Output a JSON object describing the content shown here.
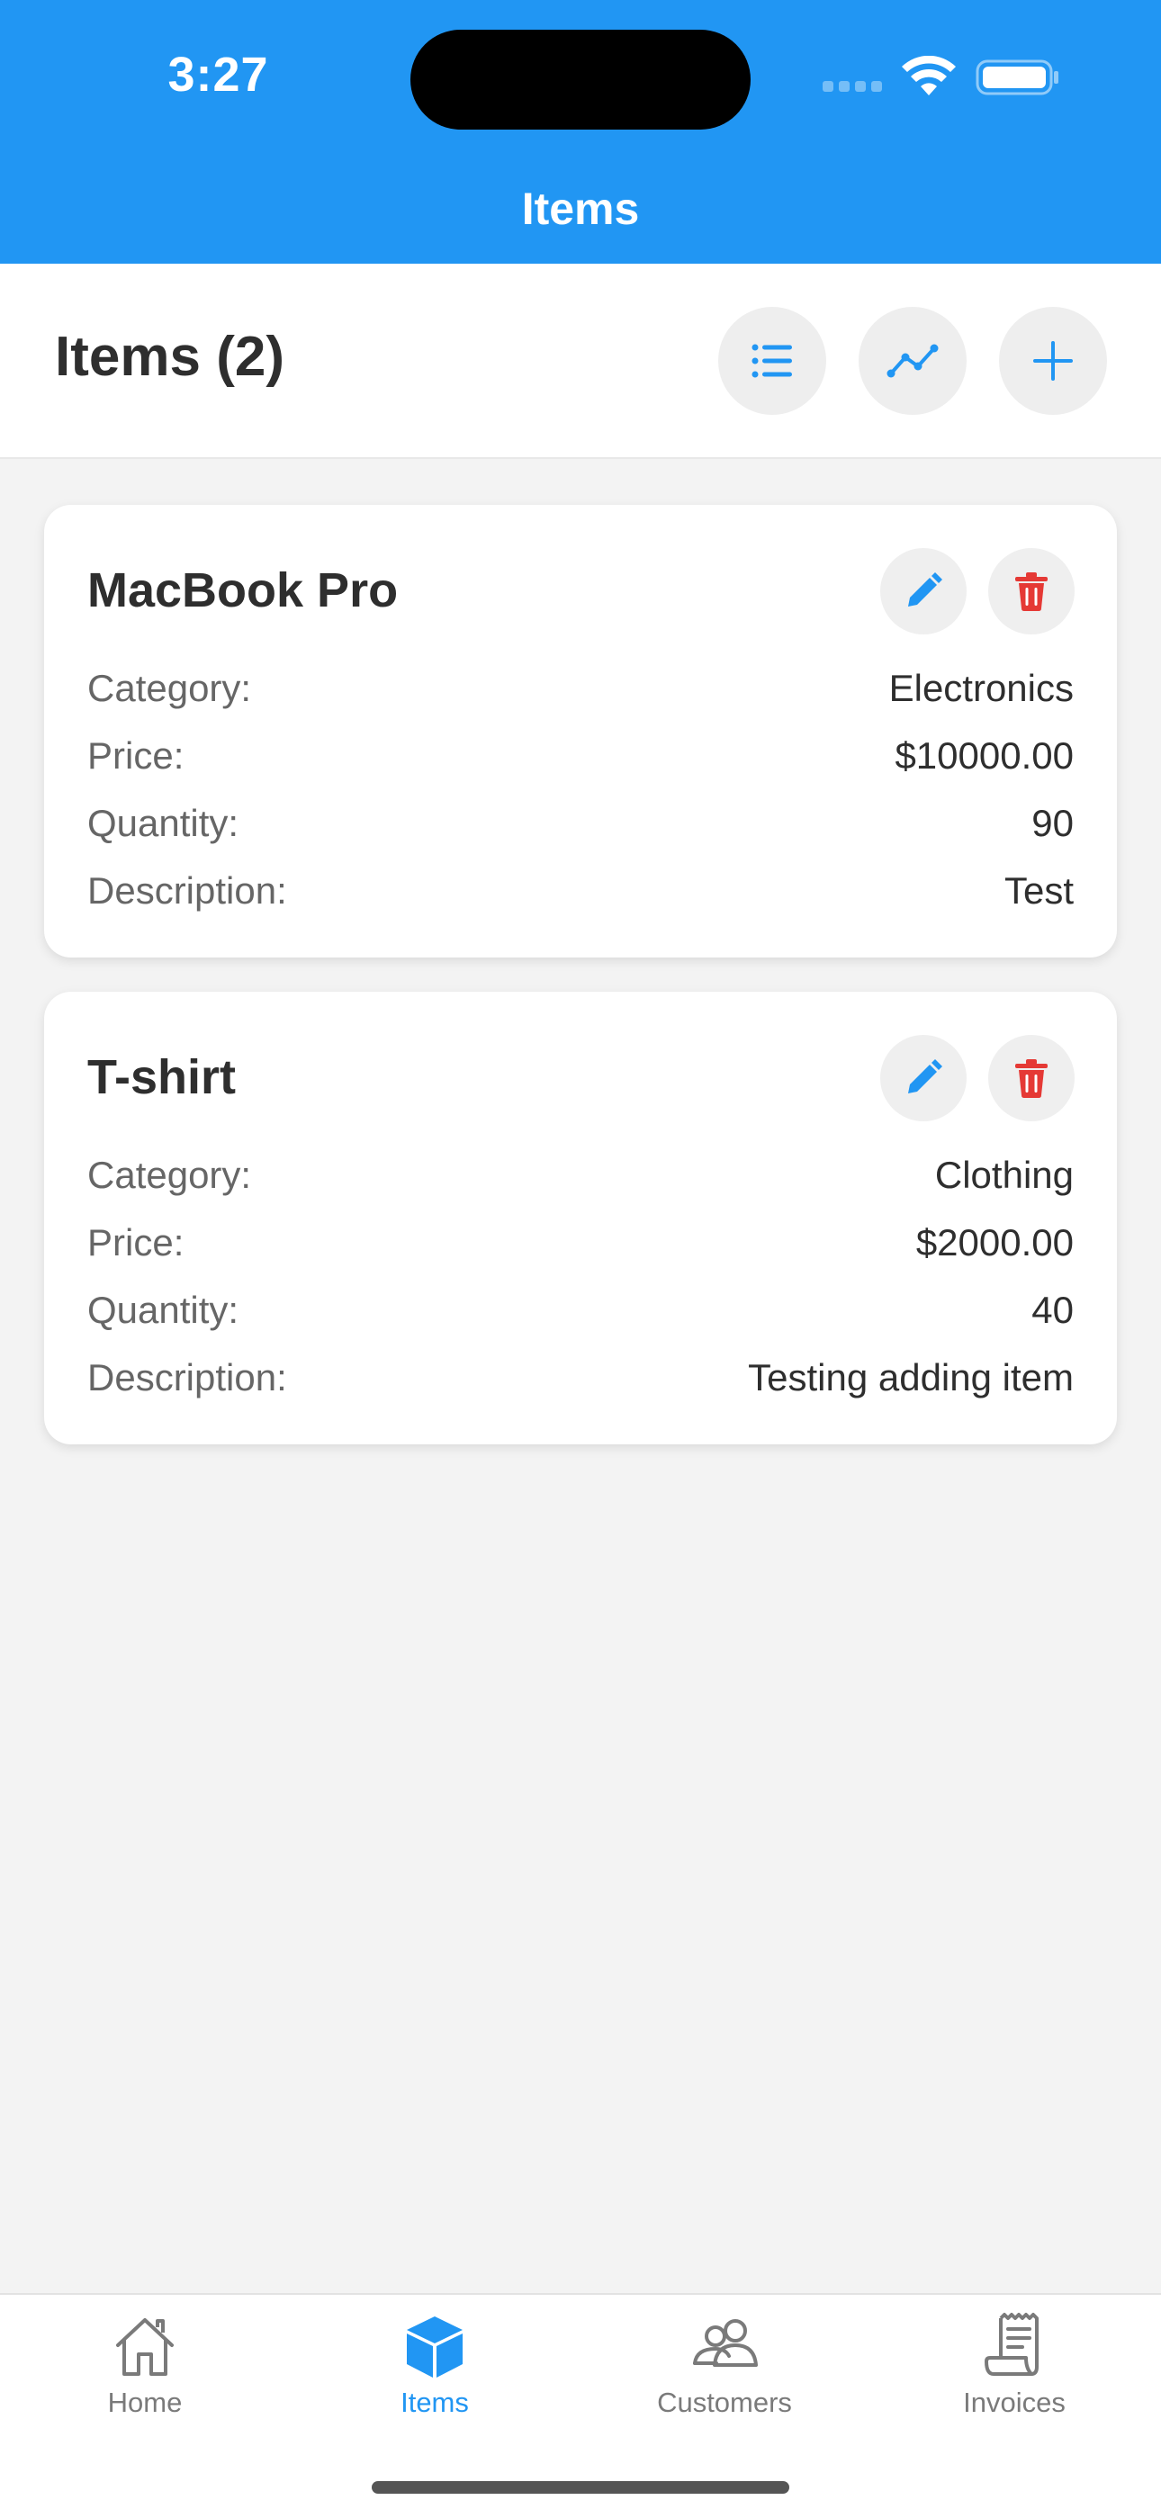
{
  "status_bar": {
    "time": "3:27"
  },
  "nav": {
    "title": "Items"
  },
  "toolbar": {
    "title": "Items (2)",
    "buttons": [
      {
        "icon": "list-icon"
      },
      {
        "icon": "chart-line-icon"
      },
      {
        "icon": "plus-icon"
      }
    ]
  },
  "labels": {
    "category": "Category:",
    "price": "Price:",
    "quantity": "Quantity:",
    "description": "Description:"
  },
  "items": [
    {
      "name": "MacBook Pro",
      "category": "Electronics",
      "price": "$10000.00",
      "quantity": "90",
      "description": "Test"
    },
    {
      "name": "T-shirt",
      "category": "Clothing",
      "price": "$2000.00",
      "quantity": "40",
      "description": "Testing adding item"
    }
  ],
  "tabbar": {
    "tabs": [
      {
        "label": "Home",
        "icon": "home-icon",
        "active": false
      },
      {
        "label": "Items",
        "icon": "cube-icon",
        "active": true
      },
      {
        "label": "Customers",
        "icon": "users-icon",
        "active": false
      },
      {
        "label": "Invoices",
        "icon": "receipt-icon",
        "active": false
      }
    ]
  },
  "colors": {
    "accent": "#2196f3",
    "danger": "#e53935",
    "background": "#f3f3f3"
  }
}
